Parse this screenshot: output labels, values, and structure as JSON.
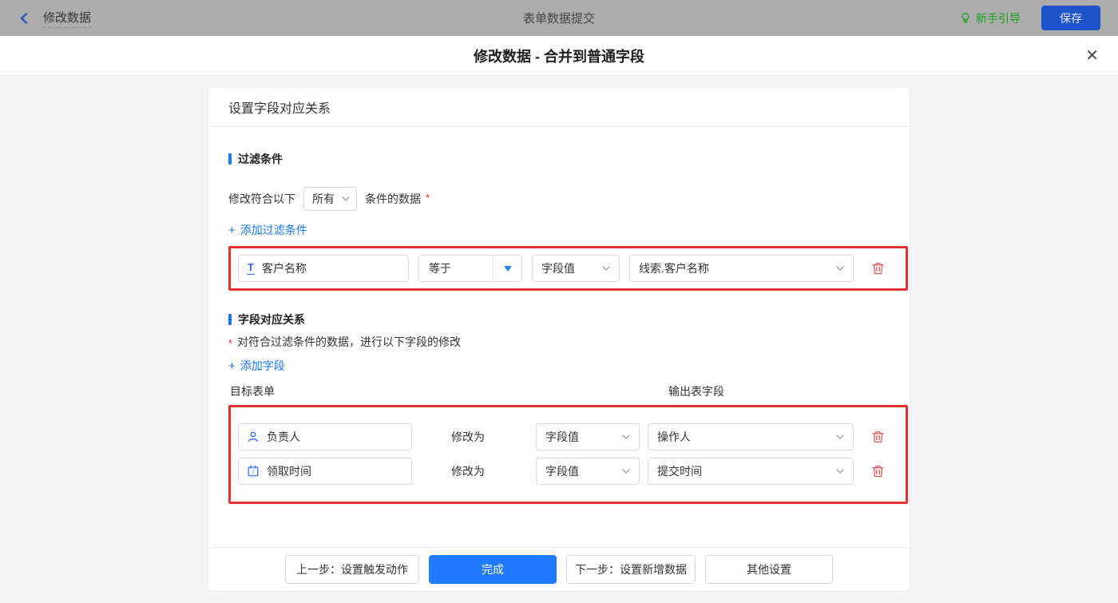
{
  "topbar": {
    "back_label": "修改数据",
    "center_title": "表单数据提交",
    "guide_label": "新手引导",
    "save_label": "保存"
  },
  "modal": {
    "title": "修改数据 - 合并到普通字段"
  },
  "icons": {
    "close": "✕",
    "plus": "+",
    "text_field": "T",
    "calendar_day": "7"
  },
  "card": {
    "header": "设置字段对应关系",
    "filter": {
      "title": "过滤条件",
      "prefix": "修改符合以下",
      "logic_value": "所有",
      "suffix": "条件的数据",
      "required": "*",
      "add_label": "添加过滤条件",
      "row": {
        "field": "客户名称",
        "operator": "等于",
        "value_type": "字段值",
        "value": "线索.客户名称"
      }
    },
    "mapping": {
      "title": "字段对应关系",
      "required": "*",
      "description": "对符合过滤条件的数据，进行以下字段的修改",
      "add_label": "添加字段",
      "col_left": "目标表单",
      "col_right": "输出表字段",
      "modify_label": "修改为",
      "rows": [
        {
          "field": "负责人",
          "value_type": "字段值",
          "value": "操作人"
        },
        {
          "field": "领取时间",
          "value_type": "字段值",
          "value": "提交时间"
        }
      ]
    },
    "footer": {
      "prev": "上一步：设置触发动作",
      "done": "完成",
      "next": "下一步：设置新增数据",
      "other": "其他设置"
    }
  },
  "colors": {
    "accent_blue": "#1677ff",
    "icon_blue": "#3370ff",
    "annotation_red": "#e23334",
    "danger_red": "#e15553",
    "guide_green": "#1ea01e",
    "save_button_blue": "#1d53c9",
    "topbar_gray": "#acacac",
    "body_gray": "#f4f4f4"
  }
}
